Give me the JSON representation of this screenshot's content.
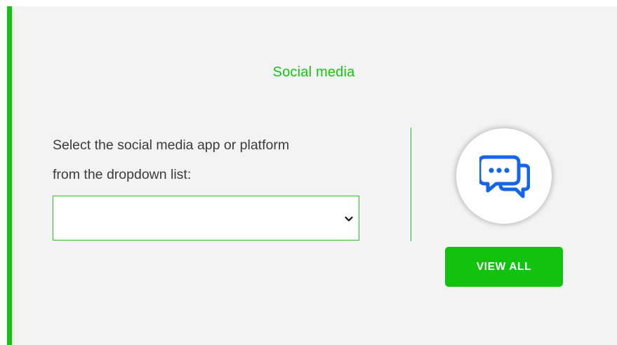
{
  "section": {
    "title": "Social media",
    "prompt_line1": "Select the social media app or platform",
    "prompt_line2": "from the dropdown list:"
  },
  "dropdown": {
    "selected_value": ""
  },
  "icon": {
    "name": "chat-bubbles-icon"
  },
  "buttons": {
    "view_all_label": "VIEW ALL"
  },
  "colors": {
    "accent": "#11c20e",
    "icon_blue": "#1565e8",
    "card_background": "#f3f3f3"
  }
}
